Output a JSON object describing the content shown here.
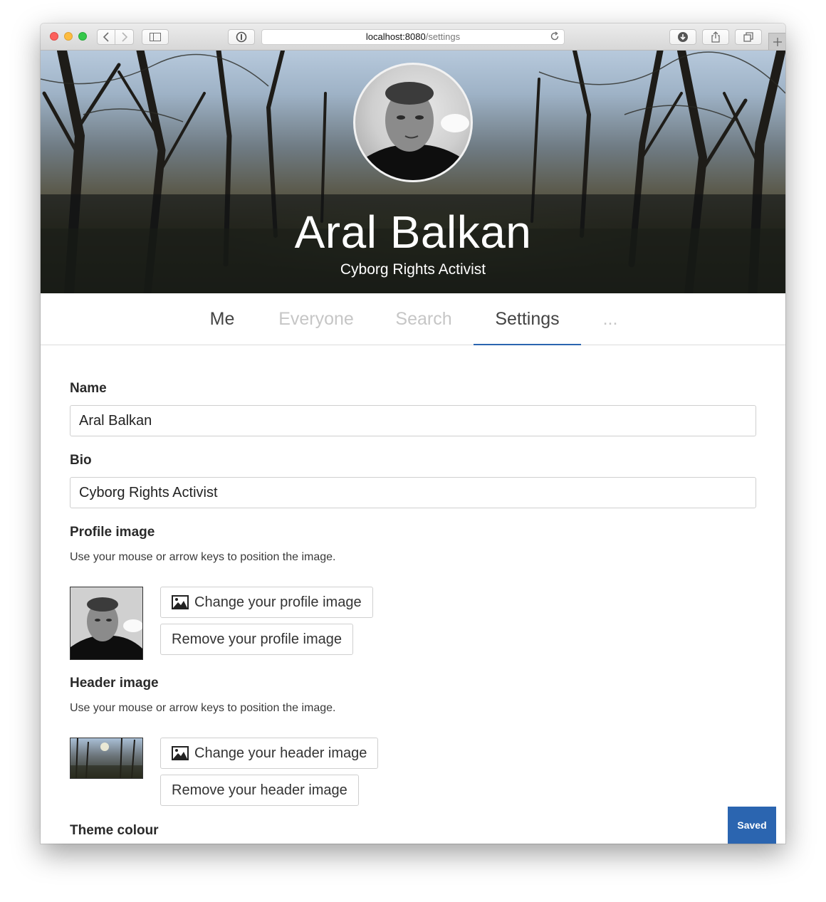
{
  "browser": {
    "url_host": "localhost:8080",
    "url_path": "/settings"
  },
  "profile": {
    "name": "Aral Balkan",
    "bio": "Cyborg Rights Activist"
  },
  "tabs": [
    {
      "label": "Me",
      "state": "normal"
    },
    {
      "label": "Everyone",
      "state": "muted"
    },
    {
      "label": "Search",
      "state": "muted"
    },
    {
      "label": "Settings",
      "state": "active"
    },
    {
      "label": "...",
      "state": "muted"
    }
  ],
  "form": {
    "name_label": "Name",
    "name_value": "Aral Balkan",
    "bio_label": "Bio",
    "bio_value": "Cyborg Rights Activist",
    "profile_image_label": "Profile image",
    "profile_image_hint": "Use your mouse or arrow keys to position the image.",
    "change_profile_image": "Change your profile image",
    "remove_profile_image": "Remove your profile image",
    "header_image_label": "Header image",
    "header_image_hint": "Use your mouse or arrow keys to position the image.",
    "change_header_image": "Change your header image",
    "remove_header_image": "Remove your header image",
    "theme_colour_label": "Theme colour"
  },
  "status": {
    "saved_label": "Saved"
  },
  "colors": {
    "accent": "#2b65b0",
    "tab_muted": "#c6c6c6",
    "tab_active": "#444444"
  },
  "icons": [
    "back-arrow-icon",
    "forward-arrow-icon",
    "sidebar-icon",
    "privacy-info-icon",
    "reload-icon",
    "download-icon",
    "share-icon",
    "tabs-overview-icon",
    "plus-icon",
    "image-icon"
  ]
}
